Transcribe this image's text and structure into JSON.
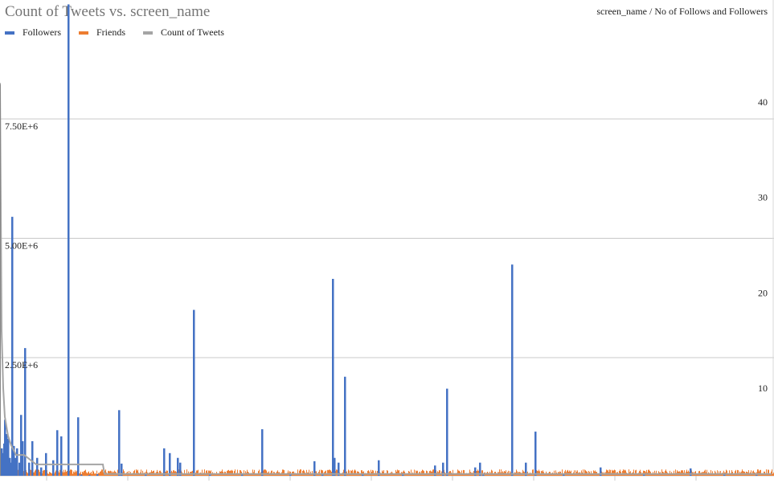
{
  "chart_data": {
    "type": "bar",
    "title": "Count of Tweets vs. screen_name",
    "right_axis_title": "screen_name / No of Follows and Followers",
    "left_axis": {
      "ticks": [
        "2.50E+6",
        "5.00E+6",
        "7.50E+6"
      ],
      "tick_values": [
        2500000,
        5000000,
        7500000
      ],
      "ylim": [
        0,
        10000000
      ]
    },
    "right_axis": {
      "ticks": [
        "10",
        "30",
        "20",
        "40"
      ],
      "tick_values": [
        10,
        30,
        20,
        40
      ],
      "ylim": [
        0,
        50
      ]
    },
    "grid": true,
    "legend_position": "top-left",
    "series": [
      {
        "name": "Followers",
        "color": "#4472c4",
        "type": "bar",
        "points": [
          [
            1,
            600000
          ],
          [
            3,
            500000
          ],
          [
            4,
            700000
          ],
          [
            5,
            1200000
          ],
          [
            7,
            900000
          ],
          [
            9,
            800000
          ],
          [
            11,
            400000
          ],
          [
            12,
            300000
          ],
          [
            14,
            5450000
          ],
          [
            16,
            650000
          ],
          [
            18,
            400000
          ],
          [
            20,
            600000
          ],
          [
            23,
            300000
          ],
          [
            25,
            1300000
          ],
          [
            27,
            750000
          ],
          [
            30,
            2700000
          ],
          [
            35,
            300000
          ],
          [
            39,
            750000
          ],
          [
            45,
            400000
          ],
          [
            50,
            200000
          ],
          [
            56,
            500000
          ],
          [
            65,
            350000
          ],
          [
            70,
            980000
          ],
          [
            75,
            850000
          ],
          [
            84,
            9900000
          ],
          [
            96,
            1250000
          ],
          [
            100,
            50000
          ],
          [
            110,
            40000
          ],
          [
            120,
            60000
          ],
          [
            147,
            1400000
          ],
          [
            150,
            280000
          ],
          [
            180,
            60000
          ],
          [
            203,
            600000
          ],
          [
            210,
            500000
          ],
          [
            220,
            400000
          ],
          [
            223,
            300000
          ],
          [
            240,
            3500000
          ],
          [
            260,
            60000
          ],
          [
            300,
            80000
          ],
          [
            325,
            1000000
          ],
          [
            360,
            60000
          ],
          [
            390,
            330000
          ],
          [
            400,
            80000
          ],
          [
            413,
            4150000
          ],
          [
            415,
            400000
          ],
          [
            420,
            300000
          ],
          [
            428,
            2100000
          ],
          [
            450,
            60000
          ],
          [
            470,
            350000
          ],
          [
            500,
            80000
          ],
          [
            540,
            240000
          ],
          [
            550,
            300000
          ],
          [
            555,
            1850000
          ],
          [
            590,
            200000
          ],
          [
            596,
            300000
          ],
          [
            600,
            80000
          ],
          [
            636,
            4450000
          ],
          [
            653,
            300000
          ],
          [
            665,
            950000
          ],
          [
            700,
            60000
          ],
          [
            746,
            200000
          ],
          [
            800,
            60000
          ],
          [
            858,
            180000
          ],
          [
            900,
            60000
          ],
          [
            940,
            40000
          ]
        ]
      },
      {
        "name": "Friends",
        "color": "#ed7d31",
        "type": "bar",
        "typical_range": [
          0,
          50000
        ]
      },
      {
        "name": "Count of Tweets",
        "color": "#a5a5a5",
        "type": "line",
        "points": [
          [
            0,
            42
          ],
          [
            2,
            16
          ],
          [
            4,
            10
          ],
          [
            6,
            7
          ],
          [
            8,
            6
          ],
          [
            10,
            5
          ],
          [
            14,
            4
          ],
          [
            20,
            3
          ],
          [
            30,
            3
          ],
          [
            45,
            2
          ],
          [
            128,
            2
          ],
          [
            130,
            1
          ],
          [
            960,
            1
          ]
        ]
      }
    ]
  }
}
